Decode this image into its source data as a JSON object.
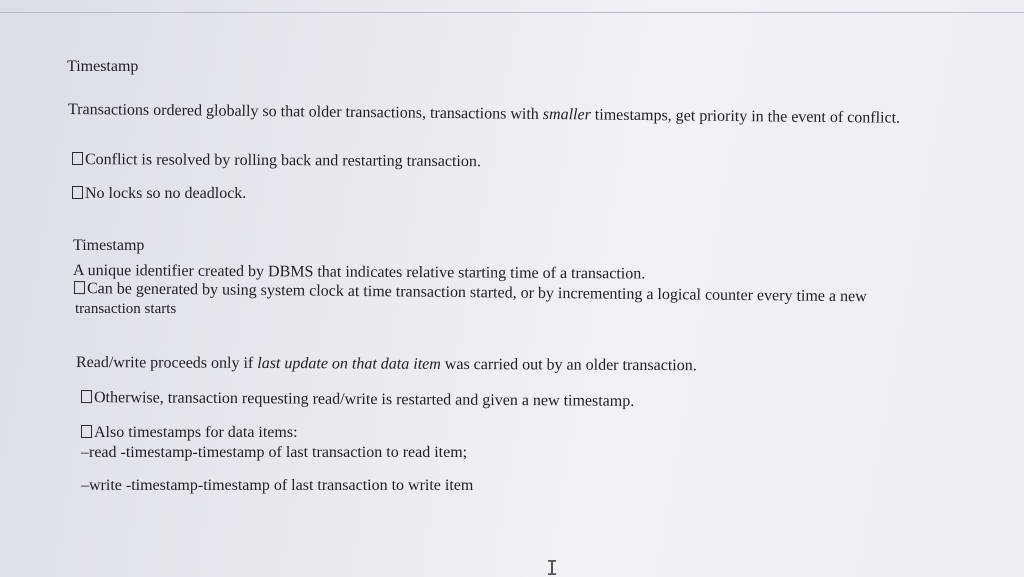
{
  "block1": {
    "heading": "Timestamp",
    "para_pre": "Transactions ordered globally so that older transactions, transactions with ",
    "para_em": "smaller",
    "para_post": " timestamps, get priority in the event of conflict.",
    "bullet1": "Conflict is resolved by rolling back and restarting transaction.",
    "bullet2": "No locks so no deadlock."
  },
  "block2": {
    "heading": "Timestamp",
    "line1": "A unique identifier created by DBMS that indicates relative starting time of a transaction.",
    "bullet1": "Can be generated by using system clock at time transaction started, or by incrementing a logical counter every time a new",
    "bullet1_cont": "transaction starts"
  },
  "block3": {
    "para_pre": "Read/write proceeds only if ",
    "para_em": "last update on that data item",
    "para_post": " was carried out by an older transaction.",
    "bullet1": "Otherwise, transaction requesting read/write is restarted and given a new timestamp.",
    "bullet2": "Also timestamps for data items:",
    "sub1": "–read -timestamp-timestamp of last transaction to read item;",
    "sub2": "–write -timestamp-timestamp of last transaction to write item"
  }
}
